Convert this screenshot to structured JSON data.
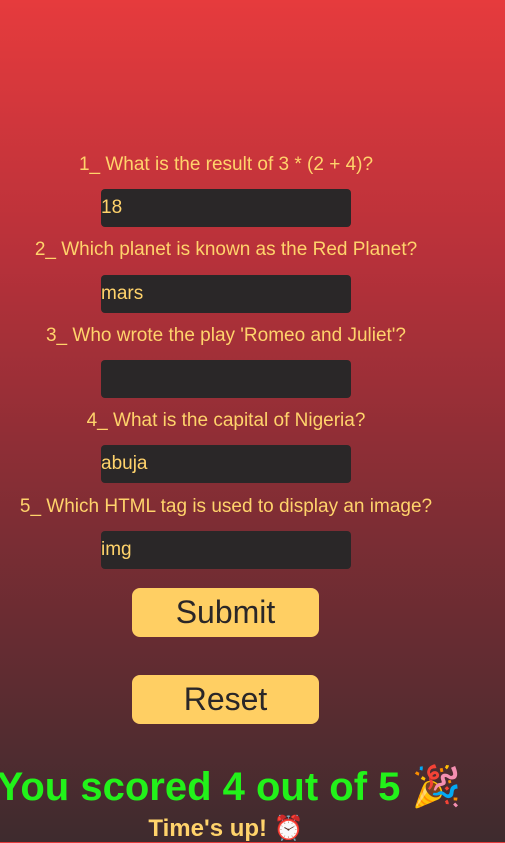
{
  "questions": [
    {
      "text": "1_ What is the result of 3 * (2 + 4)?",
      "answer": "18"
    },
    {
      "text": "2_ Which planet is known as the Red Planet?",
      "answer": "mars"
    },
    {
      "text": "3_ Who wrote the play 'Romeo and Juliet'?",
      "answer": ""
    },
    {
      "text": "4_ What is the capital of Nigeria?",
      "answer": "abuja"
    },
    {
      "text": "5_ Which HTML tag is used to display an image?",
      "answer": "img"
    }
  ],
  "buttons": {
    "submit_label": "Submit",
    "reset_label": "Reset"
  },
  "result": {
    "score_text": "You scored 4 out of 5",
    "score_emoji": "🎉",
    "time_text": "Time's up!",
    "time_emoji": "⏰"
  },
  "colors": {
    "text_gold": "#ffd36b",
    "input_bg": "#2a2728",
    "button_bg": "#ffcf63",
    "score_green": "#22f21a"
  },
  "icons": {
    "score": "party-popper-icon",
    "time": "alarm-clock-icon"
  }
}
